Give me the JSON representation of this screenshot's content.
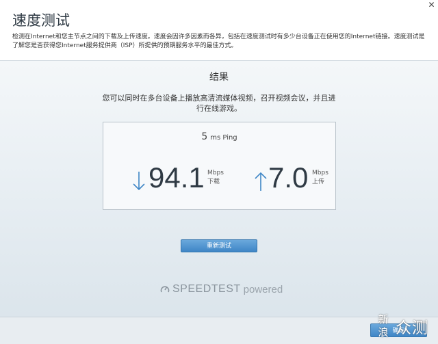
{
  "window": {
    "title": "速度测试",
    "close_glyph": "✕",
    "description": "检测在Internet和您主节点之间的下载及上传速度。速度会因许多因素而各异，包括在速度测试时有多少台设备正在使用您的Internet链接。速度测试是了解您是否获得您Internet服务提供商（ISP）所提供的预期服务水平的最佳方式。"
  },
  "result": {
    "heading": "结果",
    "message": "您可以同时在多台设备上播放高清流媒体视频，召开视频会议，并且进行在线游戏。",
    "ping_value": "5",
    "ping_unit": "ms Ping",
    "download": {
      "value": "94.1",
      "unit": "Mbps",
      "label": "下载",
      "icon": "arrow-down-icon"
    },
    "upload": {
      "value": "7.0",
      "unit": "Mbps",
      "label": "上传",
      "icon": "arrow-up-icon"
    }
  },
  "actions": {
    "rerun_label": "重新测试",
    "ok_label": "确定"
  },
  "branding": {
    "brand": "SPEEDTEST",
    "suffix": "powered",
    "icon": "speedometer-icon"
  },
  "watermark": {
    "logo_top": "新",
    "logo_bottom": "浪",
    "name": "众测"
  },
  "colors": {
    "accent": "#4a90d0",
    "arrow": "#3f86c6"
  }
}
